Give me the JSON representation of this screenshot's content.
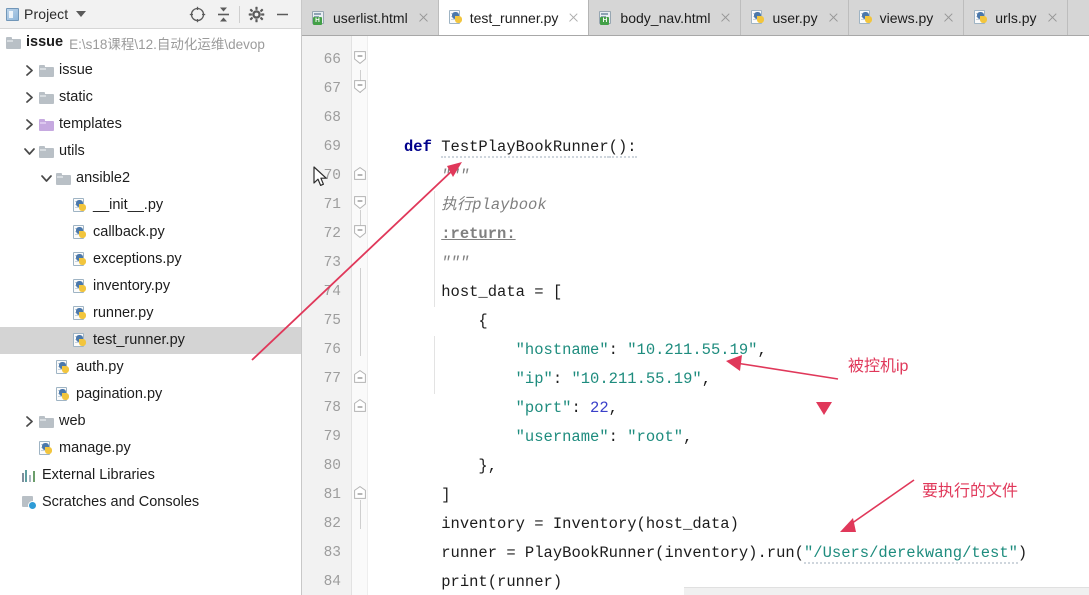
{
  "project_panel": {
    "title": "Project",
    "icons": {
      "project": "project-icon",
      "caret": "chevron-down-icon",
      "locate": "locate-crosshair-icon",
      "collapse_all": "collapse-all-icon",
      "settings": "gear-icon",
      "hide": "minimize-icon"
    },
    "root": {
      "name": "issue",
      "path": "E:\\s18课程\\12.自动化运维\\devop"
    },
    "tree": [
      {
        "label": "issue",
        "depth": 1,
        "type": "folder",
        "twisty": "right",
        "selected": false
      },
      {
        "label": "static",
        "depth": 1,
        "type": "folder",
        "twisty": "right",
        "selected": false
      },
      {
        "label": "templates",
        "depth": 1,
        "type": "folder-purple",
        "twisty": "right",
        "selected": false
      },
      {
        "label": "utils",
        "depth": 1,
        "type": "folder",
        "twisty": "down",
        "selected": false
      },
      {
        "label": "ansible2",
        "depth": 2,
        "type": "folder",
        "twisty": "down",
        "selected": false
      },
      {
        "label": "__init__.py",
        "depth": 3,
        "type": "python",
        "twisty": "none",
        "selected": false
      },
      {
        "label": "callback.py",
        "depth": 3,
        "type": "python",
        "twisty": "none",
        "selected": false
      },
      {
        "label": "exceptions.py",
        "depth": 3,
        "type": "python",
        "twisty": "none",
        "selected": false
      },
      {
        "label": "inventory.py",
        "depth": 3,
        "type": "python",
        "twisty": "none",
        "selected": false
      },
      {
        "label": "runner.py",
        "depth": 3,
        "type": "python",
        "twisty": "none",
        "selected": false
      },
      {
        "label": "test_runner.py",
        "depth": 3,
        "type": "python",
        "twisty": "none",
        "selected": true
      },
      {
        "label": "auth.py",
        "depth": 2,
        "type": "python",
        "twisty": "none",
        "selected": false
      },
      {
        "label": "pagination.py",
        "depth": 2,
        "type": "python",
        "twisty": "none",
        "selected": false
      },
      {
        "label": "web",
        "depth": 1,
        "type": "folder",
        "twisty": "right",
        "selected": false
      },
      {
        "label": "manage.py",
        "depth": 1,
        "type": "python",
        "twisty": "none",
        "selected": false
      },
      {
        "label": "External Libraries",
        "depth": 0,
        "type": "library",
        "twisty": "none",
        "selected": false
      },
      {
        "label": "Scratches and Consoles",
        "depth": 0,
        "type": "scratch",
        "twisty": "none",
        "selected": false
      }
    ]
  },
  "editor": {
    "tabs": [
      {
        "label": "userlist.html",
        "type": "html",
        "active": false
      },
      {
        "label": "test_runner.py",
        "type": "python",
        "active": true
      },
      {
        "label": "body_nav.html",
        "type": "html",
        "active": false
      },
      {
        "label": "user.py",
        "type": "python",
        "active": false
      },
      {
        "label": "views.py",
        "type": "python",
        "active": false
      },
      {
        "label": "urls.py",
        "type": "python",
        "active": false
      }
    ],
    "line_numbers": [
      66,
      67,
      68,
      69,
      70,
      71,
      72,
      73,
      74,
      75,
      76,
      77,
      78,
      79,
      80,
      81,
      82,
      83,
      84
    ],
    "lines": [
      {
        "n": 66,
        "text": ""
      },
      {
        "n": 67,
        "text": ""
      },
      {
        "n": 68,
        "text": ""
      },
      {
        "n": 69,
        "text": "def TestPlayBookRunner():"
      },
      {
        "n": 70,
        "text": "    \"\"\""
      },
      {
        "n": 71,
        "text": "    执行playbook"
      },
      {
        "n": 72,
        "text": "    :return:"
      },
      {
        "n": 73,
        "text": "    \"\"\""
      },
      {
        "n": 74,
        "text": "    host_data = ["
      },
      {
        "n": 75,
        "text": "        {"
      },
      {
        "n": 76,
        "text": "            \"hostname\": \"10.211.55.19\","
      },
      {
        "n": 77,
        "text": "            \"ip\": \"10.211.55.19\","
      },
      {
        "n": 78,
        "text": "            \"port\": 22,"
      },
      {
        "n": 79,
        "text": "            \"username\": \"root\","
      },
      {
        "n": 80,
        "text": "        },"
      },
      {
        "n": 81,
        "text": "    ]"
      },
      {
        "n": 82,
        "text": "    inventory = Inventory(host_data)"
      },
      {
        "n": 83,
        "text": "    runner = PlayBookRunner(inventory).run(\"/Users/derekwang/test\")"
      },
      {
        "n": 84,
        "text": "    print(runner)"
      }
    ],
    "tokens": {
      "kw_def": "def",
      "fn_name": "TestPlayBookRunner",
      "docstring_quote": "\"\"\"",
      "doc_cn": "执行playbook",
      "doc_return": ":return:",
      "host_data": "host_data = [",
      "brace_open": "{",
      "k_hostname": "\"hostname\"",
      "v_hostname": "\"10.211.55.19\"",
      "k_ip": "\"ip\"",
      "v_ip": "\"10.211.55.19\"",
      "k_port": "\"port\"",
      "v_port": "22",
      "k_username": "\"username\"",
      "v_username": "\"root\"",
      "brace_close": "},",
      "bracket_close": "]",
      "inventory_line": "inventory = Inventory(host_data)",
      "runner_pre": "runner = PlayBookRunner(inventory).run(",
      "runner_path": "\"/Users/derekwang/test\"",
      "runner_post": ")",
      "print_line": "print(runner)"
    }
  },
  "annotations": [
    {
      "id": "ip-note",
      "text": "被控机ip",
      "color": "#e0385a"
    },
    {
      "id": "file-note",
      "text": "要执行的文件",
      "color": "#e0385a"
    }
  ],
  "colors": {
    "accent_red": "#e0385a",
    "string_teal": "#1e8c7e",
    "keyword_navy": "#00008b",
    "number_blue": "#3a40c9",
    "selection_gray": "#d4d4d4",
    "tabbar_gray": "#d6d6d6"
  }
}
